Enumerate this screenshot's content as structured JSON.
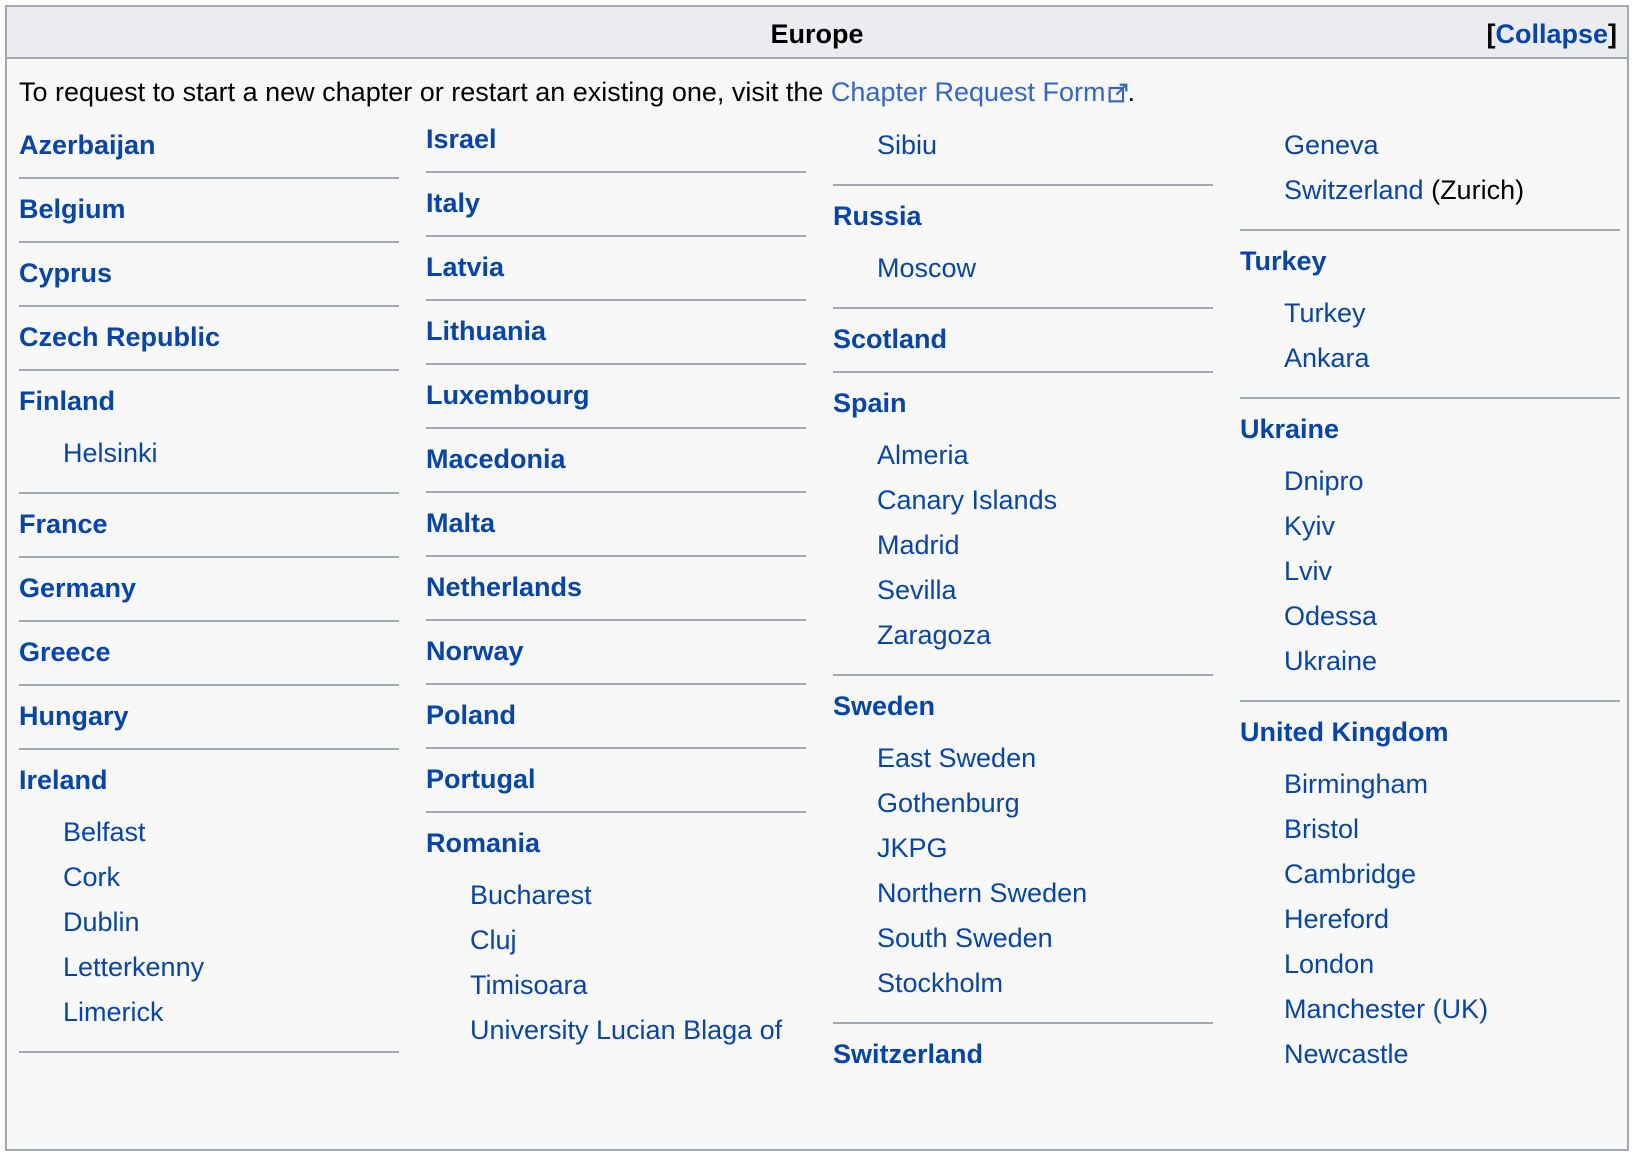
{
  "header": {
    "title": "Europe",
    "collapse_label": "Collapse",
    "bracket_open": "[",
    "bracket_close": "]"
  },
  "intro": {
    "text": "To request to start a new chapter or restart an existing one, visit the ",
    "link_label": "Chapter Request Form",
    "end": ".",
    "link_icon": "external-link-icon"
  },
  "columns": [
    {
      "groups": [
        {
          "country": "Azerbaijan",
          "cities": []
        },
        {
          "country": "Belgium",
          "cities": []
        },
        {
          "country": "Cyprus",
          "cities": []
        },
        {
          "country": "Czech Republic",
          "cities": []
        },
        {
          "country": "Finland",
          "cities": [
            "Helsinki"
          ]
        },
        {
          "country": "France",
          "cities": []
        },
        {
          "country": "Germany",
          "cities": []
        },
        {
          "country": "Greece",
          "cities": []
        },
        {
          "country": "Hungary",
          "cities": []
        },
        {
          "country": "Ireland",
          "cities": [
            "Belfast",
            "Cork",
            "Dublin",
            "Letterkenny",
            "Limerick"
          ]
        }
      ]
    },
    {
      "groups": [
        {
          "country": "Israel",
          "cities": []
        },
        {
          "country": "Italy",
          "cities": []
        },
        {
          "country": "Latvia",
          "cities": []
        },
        {
          "country": "Lithuania",
          "cities": []
        },
        {
          "country": "Luxembourg",
          "cities": []
        },
        {
          "country": "Macedonia",
          "cities": []
        },
        {
          "country": "Malta",
          "cities": []
        },
        {
          "country": "Netherlands",
          "cities": []
        },
        {
          "country": "Norway",
          "cities": []
        },
        {
          "country": "Poland",
          "cities": []
        },
        {
          "country": "Portugal",
          "cities": []
        },
        {
          "country": "Romania",
          "cities": [
            "Bucharest",
            "Cluj",
            "Timisoara",
            "University Lucian Blaga of"
          ]
        }
      ]
    },
    {
      "continuation": [
        "Sibiu"
      ],
      "groups": [
        {
          "country": "Russia",
          "cities": [
            "Moscow"
          ]
        },
        {
          "country": "Scotland",
          "cities": []
        },
        {
          "country": "Spain",
          "cities": [
            "Almeria",
            "Canary Islands",
            "Madrid",
            "Sevilla",
            "Zaragoza"
          ]
        },
        {
          "country": "Sweden",
          "cities": [
            "East Sweden",
            "Gothenburg",
            "JKPG",
            "Northern Sweden",
            "South Sweden",
            "Stockholm"
          ]
        },
        {
          "country": "Switzerland",
          "cities": []
        }
      ]
    },
    {
      "continuation": [
        "Geneva",
        "Switzerland"
      ],
      "continuation_note": "(Zurich)",
      "groups": [
        {
          "country": "Turkey",
          "cities": [
            "Turkey",
            "Ankara"
          ]
        },
        {
          "country": "Ukraine",
          "cities": [
            "Dnipro",
            "Kyiv",
            "Lviv",
            "Odessa",
            "Ukraine"
          ]
        },
        {
          "country": "United Kingdom",
          "cities": [
            "Birmingham",
            "Bristol",
            "Cambridge",
            "Hereford",
            "London",
            "Manchester (UK)",
            "Newcastle"
          ]
        }
      ]
    }
  ],
  "colors": {
    "link": "#0645ad",
    "external_link": "#3366cc",
    "border": "#a2a9b1",
    "header_bg": "#eaecf0",
    "body_bg": "#f8f8f8"
  }
}
